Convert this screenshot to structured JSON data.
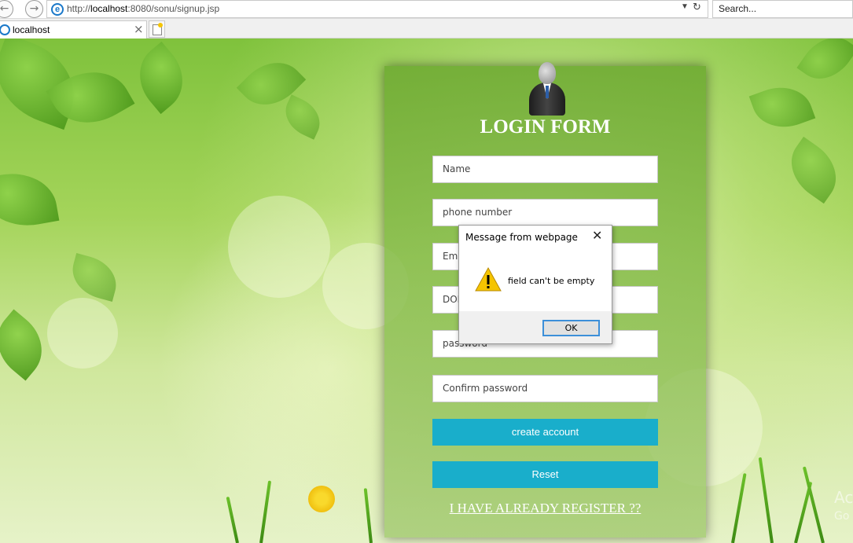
{
  "browser": {
    "url_prefix": "http://",
    "url_host": "localhost",
    "url_rest": ":8080/sonu/signup.jsp",
    "search_placeholder": "Search...",
    "tab_title": "localhost"
  },
  "form": {
    "title": "LOGIN FORM",
    "fields": {
      "name": "Name",
      "phone": "phone number",
      "email": "Emai",
      "dob": "DOI",
      "password": "password",
      "confirm": "Confirm password"
    },
    "create_label": "create account",
    "reset_label": "Reset",
    "already_link": "I HAVE ALREADY REGISTER ??"
  },
  "dialog": {
    "title": "Message from webpage",
    "message": "field can't be empty",
    "ok_label": "OK"
  },
  "watermark": {
    "line1": "Ac",
    "line2": "Go"
  },
  "colors": {
    "button": "#19aecb",
    "ok_border": "#3c8fd9",
    "warning": "#f5c400"
  }
}
